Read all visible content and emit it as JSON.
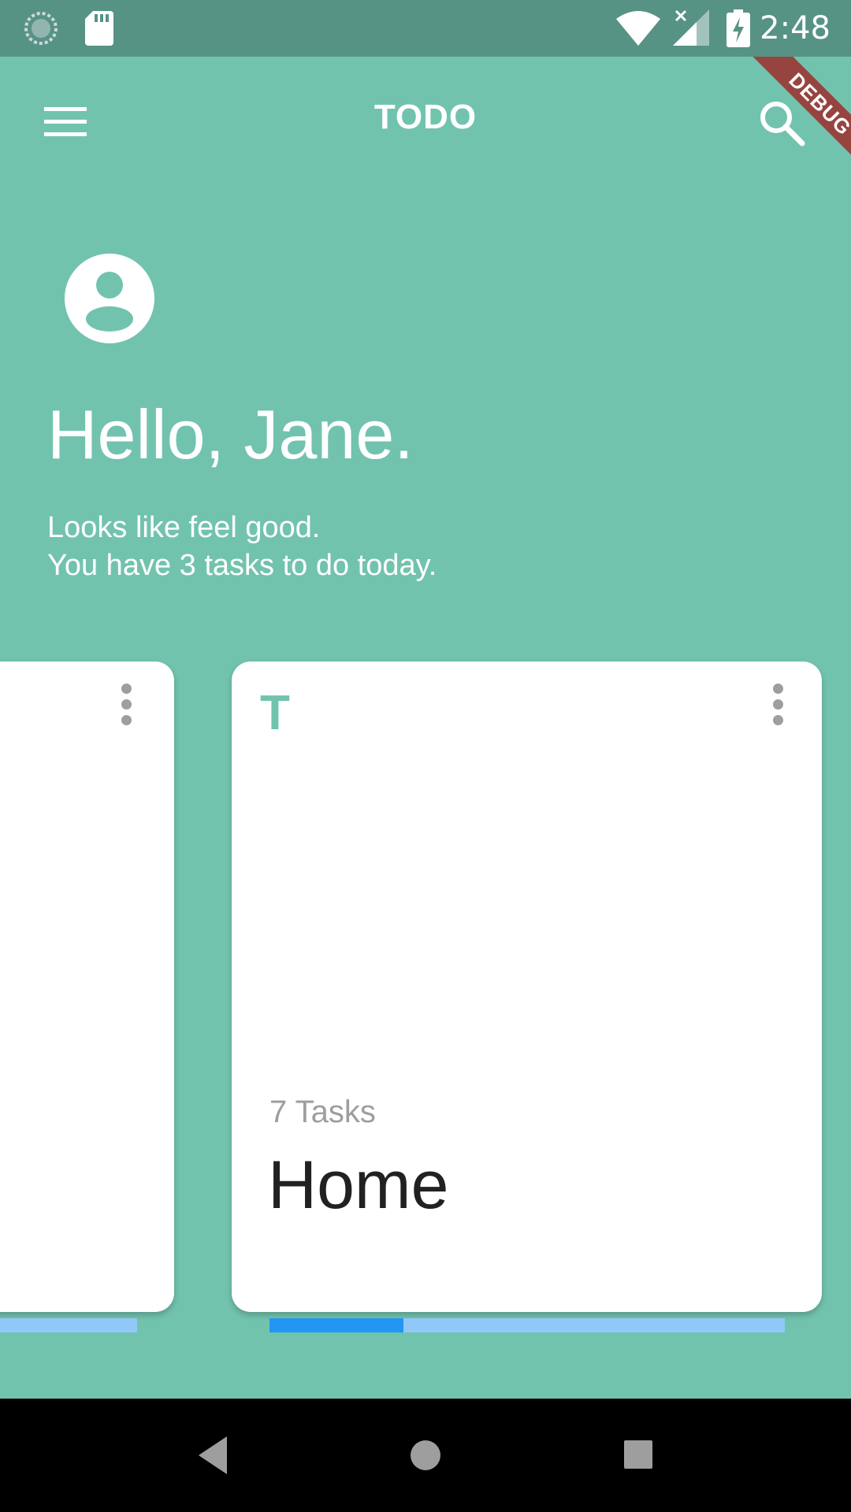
{
  "status_bar": {
    "time": "2:48",
    "icons": [
      "sync-icon",
      "sd-card-icon",
      "wifi-icon",
      "signal-icon",
      "battery-charging-icon"
    ]
  },
  "app_bar": {
    "title": "TODO",
    "menu_icon": "hamburger-menu-icon",
    "search_icon": "search-icon"
  },
  "header": {
    "avatar_icon": "account-circle-icon",
    "greeting": "Hello, Jane.",
    "subtitle_line1": "Looks like feel good.",
    "subtitle_line2": "You have 3 tasks to do today."
  },
  "cards": [
    {
      "initial": "",
      "task_count": "",
      "name": "",
      "progress": 0.0
    },
    {
      "initial": "T",
      "task_count": "7 Tasks",
      "name": "Home",
      "progress": 0.26
    }
  ],
  "debug_banner": "DEBUG",
  "nav_bar": {
    "back_icon": "back-icon",
    "home_icon": "home-icon",
    "recents_icon": "recents-icon"
  },
  "colors": {
    "status_bar": "#579385",
    "background": "#72c3ae",
    "accent": "#72c3ae",
    "progress_fill": "#2196f3",
    "progress_track": "#90c8f8"
  }
}
